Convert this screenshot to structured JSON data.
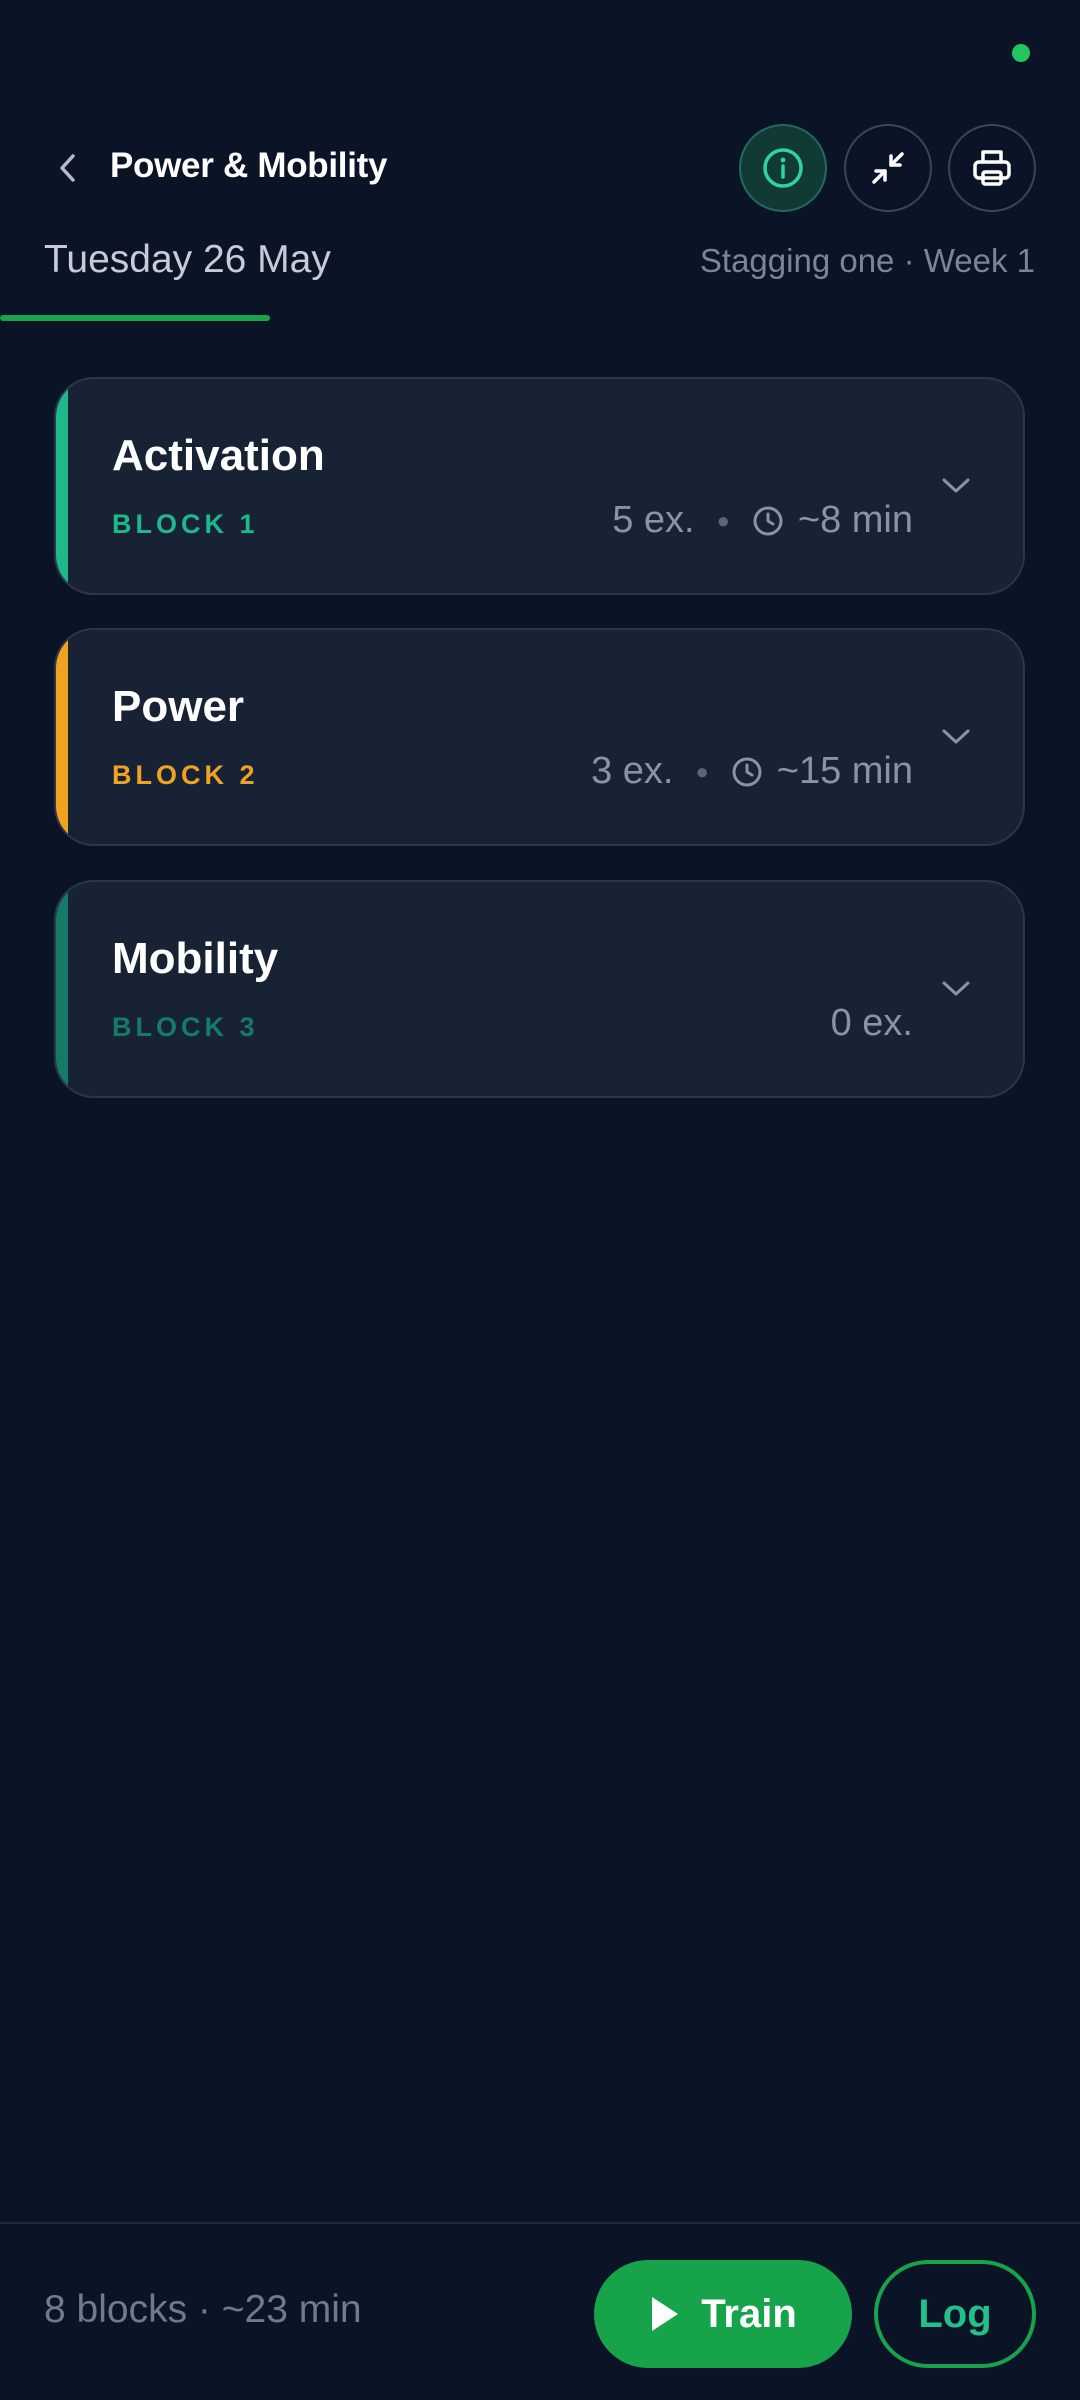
{
  "header": {
    "title": "Power & Mobility",
    "icons": {
      "back": "chevron-left-icon",
      "info": "info-icon",
      "collapse": "collapse-arrows-icon",
      "print": "printer-icon"
    }
  },
  "date_row": {
    "date": "Tuesday 26 May",
    "meta": "Stagging one · Week 1"
  },
  "blocks": [
    {
      "title": "Activation",
      "label": "BLOCK 1",
      "exercises": "5 ex.",
      "duration": "~8 min",
      "accent": "#1fb88a"
    },
    {
      "title": "Power",
      "label": "BLOCK 2",
      "exercises": "3 ex.",
      "duration": "~15 min",
      "accent": "#f0a321"
    },
    {
      "title": "Mobility",
      "label": "BLOCK 3",
      "exercises": "0 ex.",
      "duration": "",
      "accent": "#157a66"
    }
  ],
  "footer": {
    "summary": "8 blocks · ~23 min",
    "train_label": "Train",
    "log_label": "Log"
  },
  "colors": {
    "background": "#0b1426",
    "card": "#172235",
    "primary_green": "#16a34a",
    "status_dot": "#22c55e"
  }
}
